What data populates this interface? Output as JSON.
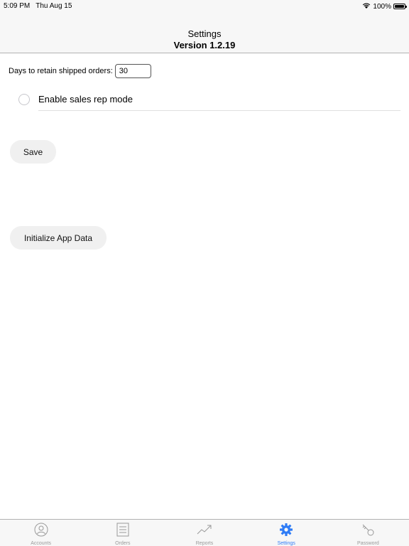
{
  "status_bar": {
    "time": "5:09 PM",
    "date": "Thu Aug 15",
    "battery": "100%"
  },
  "nav": {
    "title": "Settings",
    "subtitle": "Version 1.2.19"
  },
  "form": {
    "days_label": "Days to retain shipped orders:",
    "days_value": "30",
    "sales_rep_label": "Enable sales rep mode",
    "sales_rep_enabled": false
  },
  "buttons": {
    "save": "Save",
    "initialize": "Initialize App Data"
  },
  "tabs": [
    {
      "label": "Accounts",
      "icon": "person-icon",
      "active": false
    },
    {
      "label": "Orders",
      "icon": "list-icon",
      "active": false
    },
    {
      "label": "Reports",
      "icon": "trend-icon",
      "active": false
    },
    {
      "label": "Settings",
      "icon": "gear-icon",
      "active": true
    },
    {
      "label": "Password",
      "icon": "key-icon",
      "active": false
    }
  ],
  "colors": {
    "accent": "#2f7cf6",
    "inactive": "#999999",
    "bar_bg": "#f7f7f7"
  }
}
